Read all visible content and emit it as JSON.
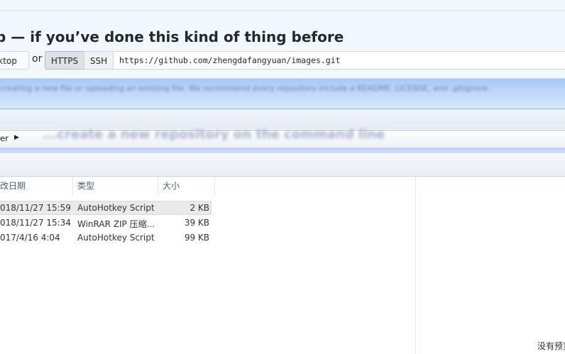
{
  "github": {
    "heading": "p — if you’ve done this kind of thing before",
    "desktop_button": "sktop",
    "or_text": "or",
    "https_button": "HTTPS",
    "ssh_button": "SSH",
    "clone_url": "https://github.com/zhengdafangyuan/images.git"
  },
  "background": {
    "blurred_text": "creating a new file or uploading an existing file. We recommend every repository include a README, LICENSE, and .gitignore.",
    "blurred_heading": "...create a new repository on the command line"
  },
  "explorer": {
    "address_text": "er",
    "columns": [
      "改日期",
      "类型",
      "大小"
    ],
    "files": [
      {
        "modified": "018/11/27 15:59",
        "type": "AutoHotkey Script",
        "size": "2 KB"
      },
      {
        "modified": "018/11/27 15:34",
        "type": "WinRAR ZIP 压缩...",
        "size": "39 KB"
      },
      {
        "modified": "017/4/16 4:04",
        "type": "AutoHotkey Script",
        "size": "99 KB"
      }
    ],
    "preview_text": "没有预览"
  }
}
